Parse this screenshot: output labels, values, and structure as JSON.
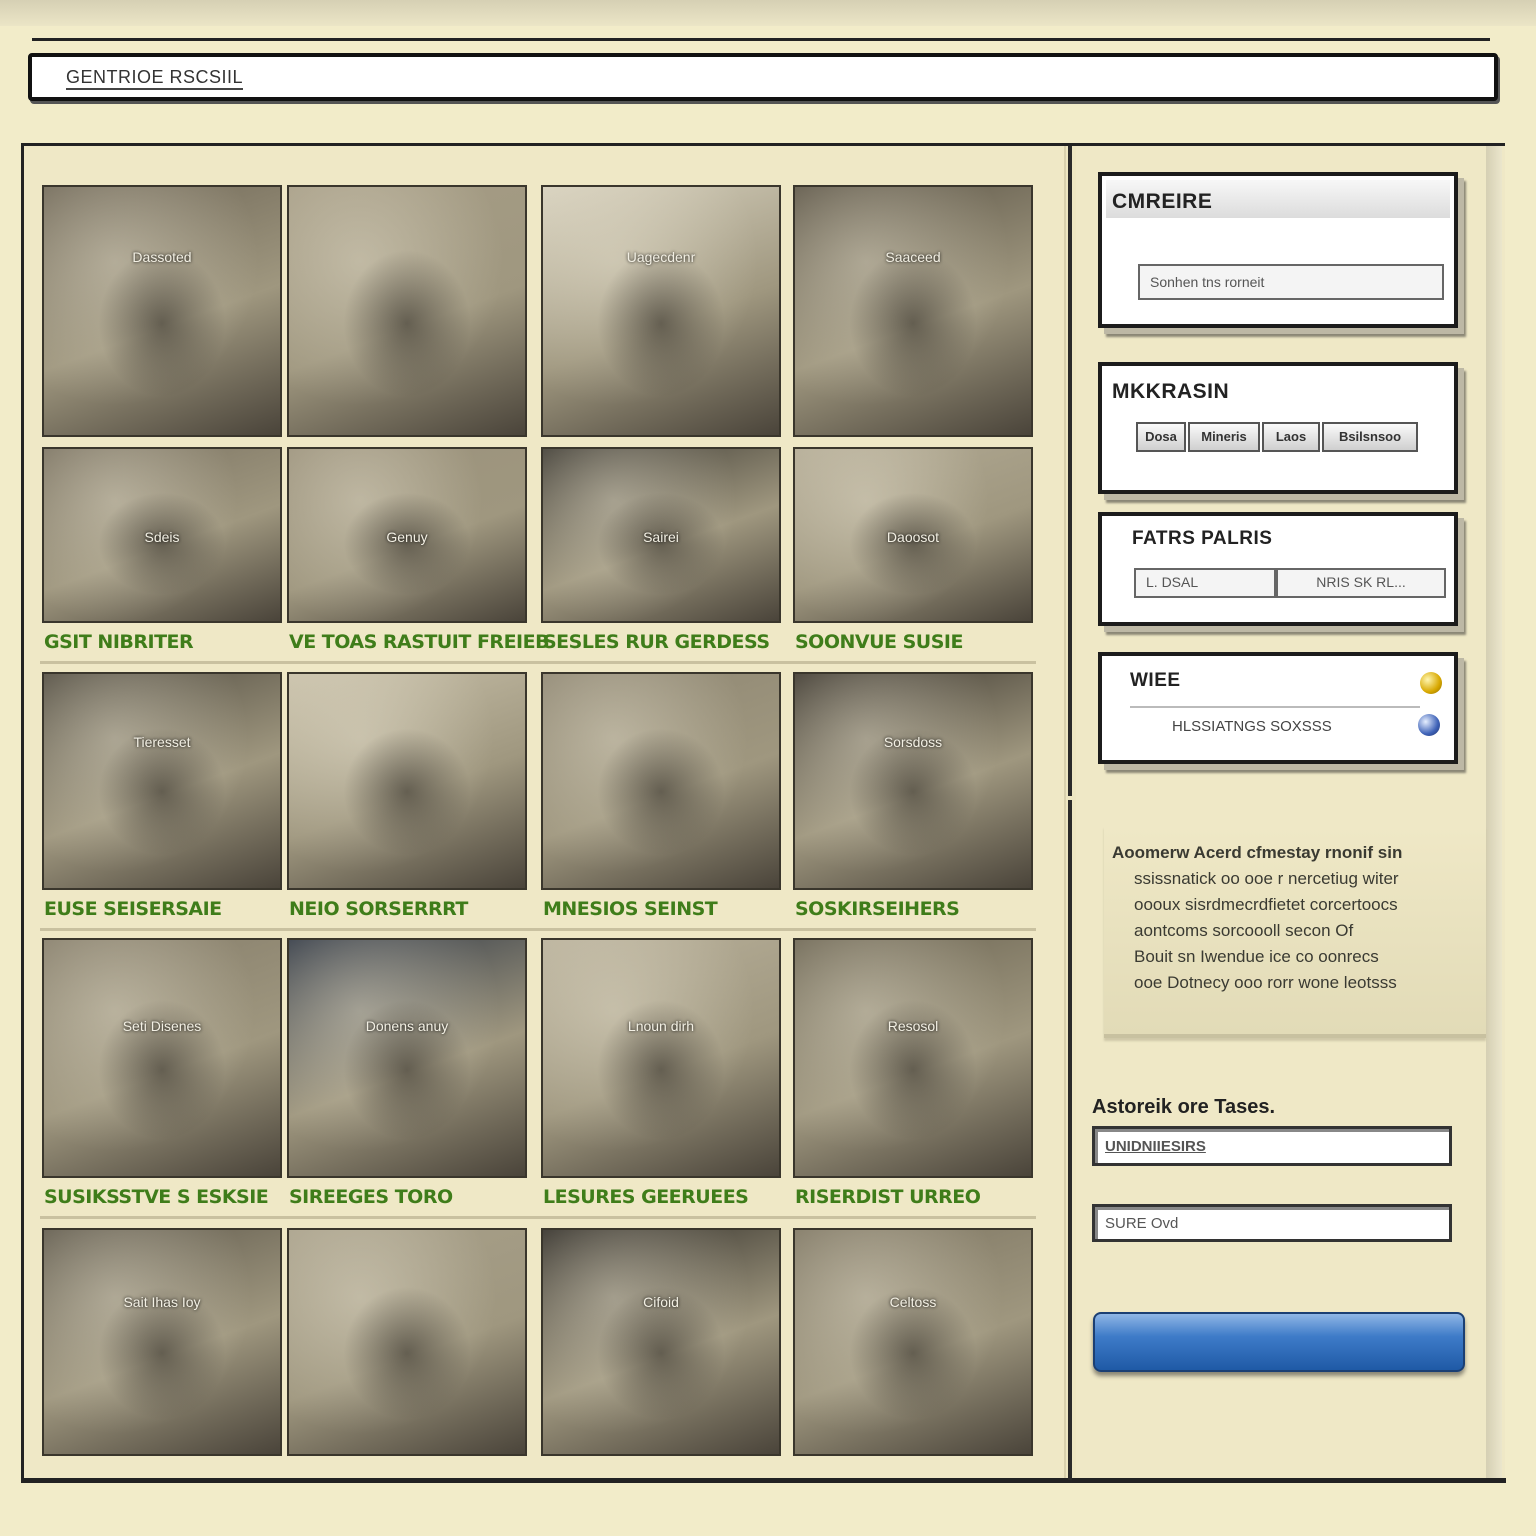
{
  "address_bar": {
    "text": "GENTRIOE RSCSIIL"
  },
  "gallery": {
    "rows": [
      {
        "tiles": [
          "Dassoted",
          "",
          "Uagecdenr",
          "Saaceed"
        ],
        "labels": []
      },
      {
        "tiles": [
          "Sdeis",
          "Genuy",
          "Sairei",
          "Daoosot"
        ],
        "labels": [
          "GSIT NIBRITER",
          "VE TOAS RASTUIT FREIEB",
          "SESLES RUR GERDESS",
          "SOONVUE SUSIE"
        ]
      },
      {
        "tiles": [
          "Tieresset",
          "",
          "",
          "Sorsdoss"
        ],
        "labels": [
          "EUSE SEISERSAIE",
          "NEIO SORSERRRT",
          "MNESIOS SEINST",
          "SOSKIRSEIHERS"
        ]
      },
      {
        "tiles": [
          "Seti Disenes",
          "Donens anuy",
          "Lnoun dirh",
          "Resosol"
        ],
        "labels": [
          "SUSIKSSTVE S ESKSIE",
          "SIREEGES TORO",
          "LESURES GEERUEES",
          "RISERDIST URREO"
        ]
      },
      {
        "tiles": [
          "Sait Ihas Ioy",
          "",
          "Cifoid",
          "Celtoss"
        ],
        "labels": []
      }
    ]
  },
  "sidebar": {
    "panel1": {
      "title": "CMREIRE",
      "field": "Sonhen tns rorneit"
    },
    "panel2": {
      "title": "MKKRASIN",
      "segments": [
        "Dosa",
        "Mineris",
        "Laos",
        "Bsilsnsoo"
      ]
    },
    "panel3": {
      "title": "FATRS PALRIS",
      "segments": [
        "L. DSAL",
        "NRIS SK RL..."
      ]
    },
    "panel4": {
      "title": "WIEE",
      "subtext": "HLSSIATNGS SOXSSS"
    },
    "note_lines": [
      "Aoomerw Acerd cfmestay rnonif sin",
      "ssissnatick oo ooe r nercetiug witer",
      "oooux sisrdmecrdfietet corcertoocs",
      "aontcoms sorcoooll secon Of",
      "Bouit sn Iwendue ice co oonrecs",
      "ooe Dotnecy ooo rorr wone leotsss"
    ],
    "form": {
      "label": "Astoreik ore Tases.",
      "input1": "UNIDNIIESIRS",
      "input2": "SURE Ovd"
    }
  }
}
